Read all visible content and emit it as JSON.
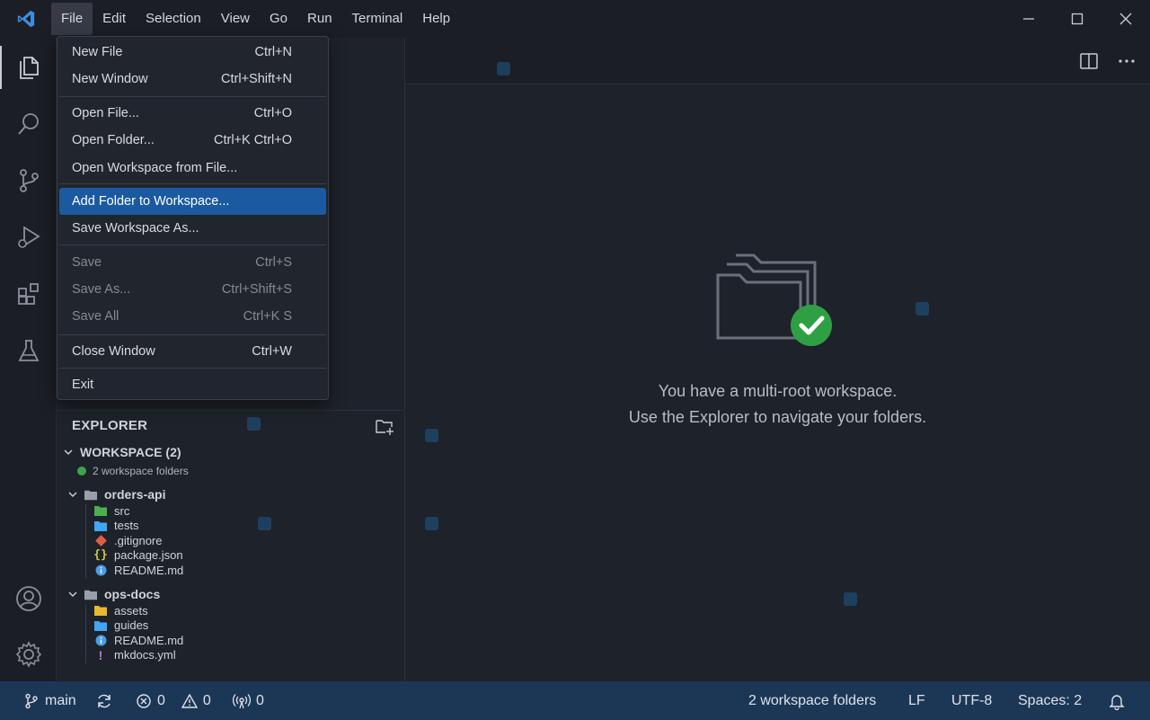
{
  "menubar": {
    "items": [
      "File",
      "Edit",
      "Selection",
      "View",
      "Go",
      "Run",
      "Terminal",
      "Help"
    ],
    "active": "File"
  },
  "file_menu": {
    "groups": [
      [
        {
          "label": "New File",
          "shortcut": "Ctrl+N",
          "enabled": true
        },
        {
          "label": "New Window",
          "shortcut": "Ctrl+Shift+N",
          "enabled": true
        }
      ],
      [
        {
          "label": "Open File...",
          "shortcut": "Ctrl+O",
          "enabled": true
        },
        {
          "label": "Open Folder...",
          "shortcut": "Ctrl+K Ctrl+O",
          "enabled": true
        },
        {
          "label": "Open Workspace from File...",
          "shortcut": "",
          "enabled": true
        }
      ],
      [
        {
          "label": "Add Folder to Workspace...",
          "shortcut": "",
          "enabled": true,
          "highlighted": true
        },
        {
          "label": "Save Workspace As...",
          "shortcut": "",
          "enabled": true
        }
      ],
      [
        {
          "label": "Save",
          "shortcut": "Ctrl+S",
          "enabled": false
        },
        {
          "label": "Save As...",
          "shortcut": "Ctrl+Shift+S",
          "enabled": false
        },
        {
          "label": "Save All",
          "shortcut": "Ctrl+K S",
          "enabled": false
        }
      ],
      [
        {
          "label": "Close Window",
          "shortcut": "Ctrl+W",
          "enabled": true
        }
      ],
      [
        {
          "label": "Exit",
          "shortcut": "",
          "enabled": true
        }
      ]
    ]
  },
  "explorer": {
    "title": "EXPLORER",
    "workspace_title": "WORKSPACE (2)",
    "workspace_subtitle": "2 workspace folders",
    "folders": [
      {
        "name": "orders-api",
        "children": [
          {
            "name": "src",
            "icon": "folder-green-icon"
          },
          {
            "name": "tests",
            "icon": "folder-blue-icon"
          },
          {
            "name": ".gitignore",
            "icon": "git-icon"
          },
          {
            "name": "package.json",
            "icon": "json-braces-icon"
          },
          {
            "name": "README.md",
            "icon": "info-icon"
          }
        ]
      },
      {
        "name": "ops-docs",
        "children": [
          {
            "name": "assets",
            "icon": "folder-yellow-icon"
          },
          {
            "name": "guides",
            "icon": "folder-blue-icon"
          },
          {
            "name": "README.md",
            "icon": "info-icon"
          },
          {
            "name": "mkdocs.yml",
            "icon": "yaml-icon"
          }
        ]
      }
    ]
  },
  "editor": {
    "welcome_line1": "You have a multi-root workspace.",
    "welcome_line2": "Use the Explorer to navigate your folders."
  },
  "statusbar": {
    "branch": "main",
    "errors": "0",
    "warnings": "0",
    "ports": "0",
    "workspace_folders": "2 workspace folders",
    "eol": "LF",
    "encoding": "UTF-8",
    "indent": "Spaces: 2"
  },
  "colors": {
    "statusbar_bg": "#1c3656",
    "menu_highlight": "#1b5aa0",
    "check_green": "#2ea043",
    "accent_blue": "#3c8ee0"
  }
}
